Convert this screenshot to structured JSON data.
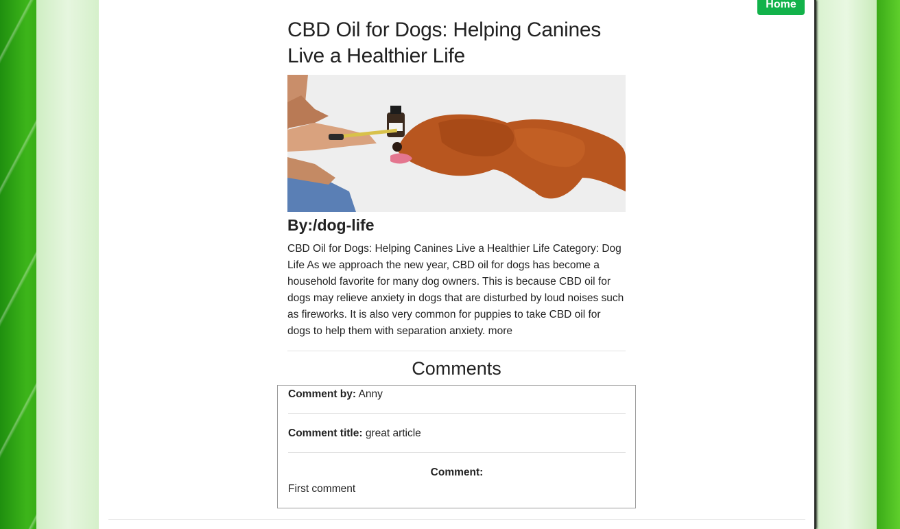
{
  "nav": {
    "home_label": "Home"
  },
  "article": {
    "title": "CBD Oil for Dogs: Helping Canines Live a Healthier Life",
    "byline": "By:/dog-life",
    "body": "CBD Oil for Dogs: Helping Canines Live a Healthier Life Category: Dog Life As we approach the new year, CBD oil for dogs has become a household favorite for many dog owners. This is because CBD oil for dogs may relieve anxiety in dogs that are disturbed by loud noises such as fireworks. It is also very common for puppies to take CBD oil for dogs to help them with separation anxiety.",
    "more_label": "more"
  },
  "comments": {
    "heading": "Comments",
    "items": [
      {
        "by_label": "Comment by:",
        "by_value": "Anny",
        "title_label": "Comment title:",
        "title_value": "great article",
        "comment_label": "Comment:",
        "comment_value": "First comment"
      }
    ]
  },
  "colors": {
    "home_button": "#12b24a",
    "text": "#222222",
    "page_bg_green": "#3db51a"
  }
}
